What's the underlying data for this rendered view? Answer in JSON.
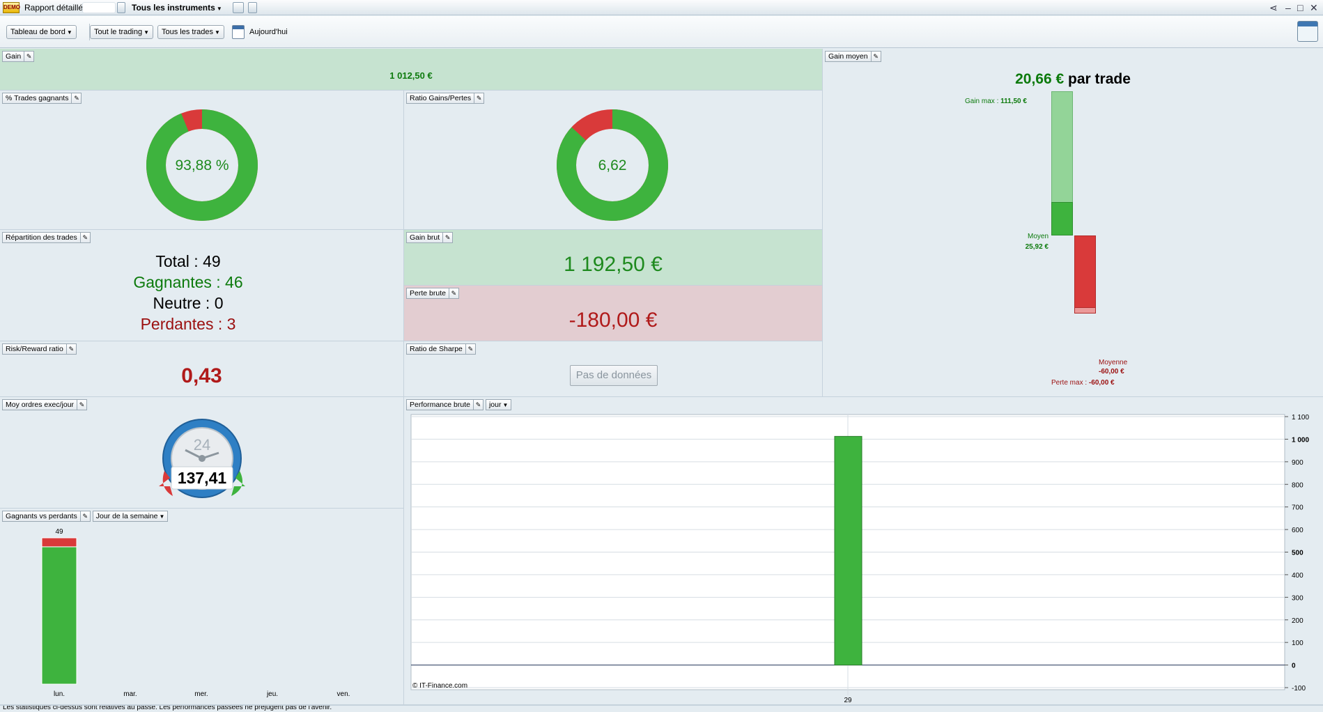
{
  "titlebar": {
    "demo_logo": "DEMO",
    "report_title": "Rapport détaillé",
    "instruments": "Tous les instruments",
    "icons": [
      "demo-logo",
      "lock-icon",
      "window-icon",
      "document-icon",
      "share-icon",
      "minimize-icon",
      "maximize-icon",
      "close-icon"
    ]
  },
  "toolbar": {
    "dashboard": "Tableau de bord",
    "trading": "Tout le trading",
    "trades": "Tous les trades",
    "today": "Aujourd'hui"
  },
  "gain": {
    "title": "Gain",
    "value": "1 012,50 €"
  },
  "win_trades": {
    "title": "% Trades gagnants",
    "value": "93,88 %",
    "win_pct": 93.88
  },
  "ratio": {
    "title": "Ratio Gains/Pertes",
    "value": "6,62",
    "win_pct": 86.9
  },
  "repartition": {
    "title": "Répartition des trades",
    "total": "Total : 49",
    "winners": "Gagnantes : 46",
    "neutral": "Neutre : 0",
    "losers": "Perdantes : 3"
  },
  "gross_gain": {
    "title": "Gain brut",
    "value": "1 192,50 €"
  },
  "gross_loss": {
    "title": "Perte brute",
    "value": "-180,00 €"
  },
  "risk_reward": {
    "title": "Risk/Reward ratio",
    "value": "0,43"
  },
  "sharpe": {
    "title": "Ratio de Sharpe",
    "no_data": "Pas de données"
  },
  "avg_gain": {
    "title": "Gain moyen",
    "value": "20,66 €",
    "suffix": "par trade",
    "max_gain_label": "Gain max :",
    "max_gain_value": "111,50 €",
    "avg_label": "Moyen",
    "avg_value": "25,92 €",
    "avg_loss_label": "Moyenne",
    "avg_loss_value": "-60,00 €",
    "max_loss_label": "Perte max :",
    "max_loss_value": "-60,00 €",
    "gain_max": 111.5,
    "gain_avg": 25.92,
    "loss_avg": -60,
    "loss_max": -60
  },
  "orders": {
    "title": "Moy ordres exec/jour",
    "value": "137,41",
    "clock_label": "24"
  },
  "winners_losers": {
    "title": "Gagnants vs perdants",
    "selector": "Jour de la semaine",
    "chart_data": {
      "type": "bar",
      "categories": [
        "lun.",
        "mar.",
        "mer.",
        "jeu.",
        "ven."
      ],
      "series": [
        {
          "name": "Gagnants",
          "values": [
            46,
            0,
            0,
            0,
            0
          ]
        },
        {
          "name": "Perdants",
          "values": [
            3,
            0,
            0,
            0,
            0
          ]
        }
      ],
      "data_labels": [
        "49",
        "",
        "",
        "",
        ""
      ],
      "colors": {
        "win": "#3eb33e",
        "loss": "#d93a3a"
      }
    }
  },
  "performance": {
    "title": "Performance brute",
    "selector": "jour",
    "copyright": "© IT-Finance.com",
    "chart_data": {
      "type": "bar",
      "categories": [
        "29"
      ],
      "values": [
        1012.5
      ],
      "ylim": [
        -100,
        1100
      ],
      "yticks": [
        -100,
        0,
        100,
        200,
        300,
        400,
        500,
        600,
        700,
        800,
        900,
        1000,
        1100
      ],
      "ytick_labels": [
        "-100",
        "0",
        "100",
        "200",
        "300",
        "400",
        "500",
        "600",
        "700",
        "800",
        "900",
        "1 000",
        "1 100"
      ],
      "bold_ticks": [
        0,
        500,
        1000
      ],
      "grid": true,
      "colors": {
        "bar": "#3eb33e"
      }
    }
  },
  "footer": {
    "text": "Les statistiques ci-dessus sont relatives au passé. Les performances passées ne préjugent pas de l'avenir."
  },
  "colors": {
    "green": "#3eb33e",
    "red": "#d93a3a",
    "text_green": "#1e8a1e",
    "text_red": "#b01a1a"
  }
}
